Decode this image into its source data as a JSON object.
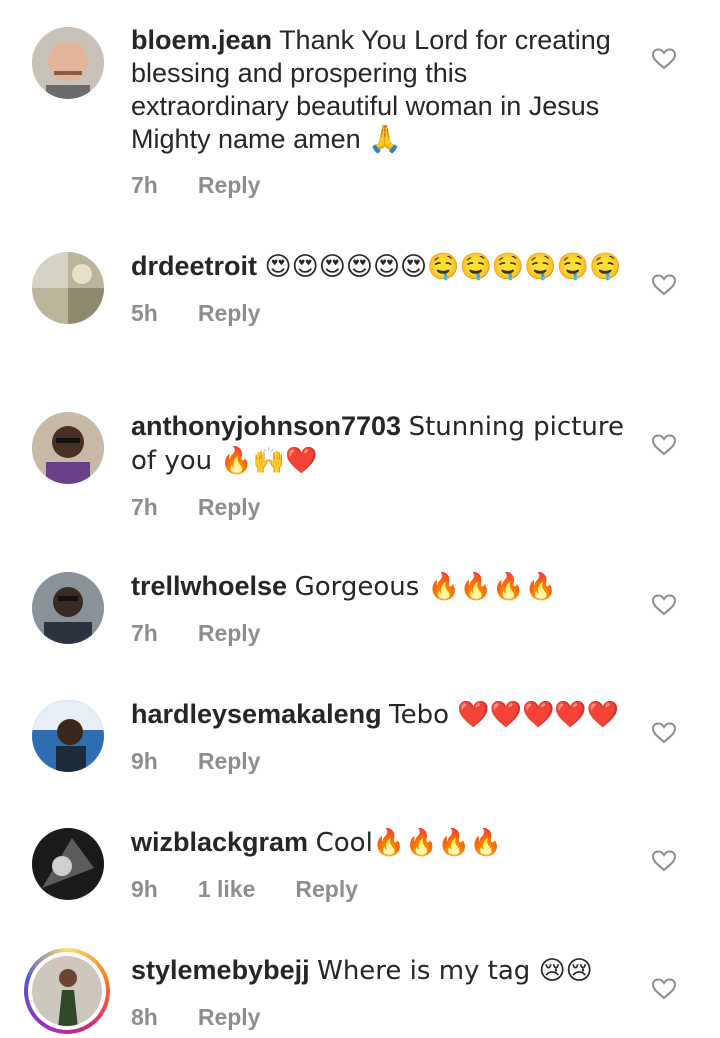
{
  "comments": [
    {
      "username": "bloem.jean",
      "text": "Thank You Lord for creating blessing and prospering this extraordinary beautiful woman in Jesus Mighty name amen 🙏",
      "time": "7h",
      "likes": "",
      "reply": "Reply"
    },
    {
      "username": "drdeetroit",
      "text": "😍😍😍😍😍😍🤤🤤🤤🤤🤤🤤",
      "time": "5h",
      "likes": "",
      "reply": "Reply"
    },
    {
      "username": "anthonyjohnson7703",
      "text": "Stunning picture of you 🔥🙌❤️",
      "time": "7h",
      "likes": "",
      "reply": "Reply"
    },
    {
      "username": "trellwhoelse",
      "text": "Gorgeous 🔥🔥🔥🔥",
      "time": "7h",
      "likes": "",
      "reply": "Reply"
    },
    {
      "username": "hardleysemakaleng",
      "text": "Tebo ❤️❤️❤️❤️❤️",
      "time": "9h",
      "likes": "",
      "reply": "Reply"
    },
    {
      "username": "wizblackgram",
      "text": "Cool🔥🔥🔥🔥",
      "time": "9h",
      "likes": "1 like",
      "reply": "Reply"
    },
    {
      "username": "stylemebybejj",
      "text": "Where is my tag 😢😢",
      "time": "8h",
      "likes": "",
      "reply": "Reply"
    }
  ],
  "icons": {
    "like": "heart-outline-icon"
  },
  "colors": {
    "meta": "#8e8e8e",
    "text": "#262626",
    "heart": "#8e8e8e"
  }
}
